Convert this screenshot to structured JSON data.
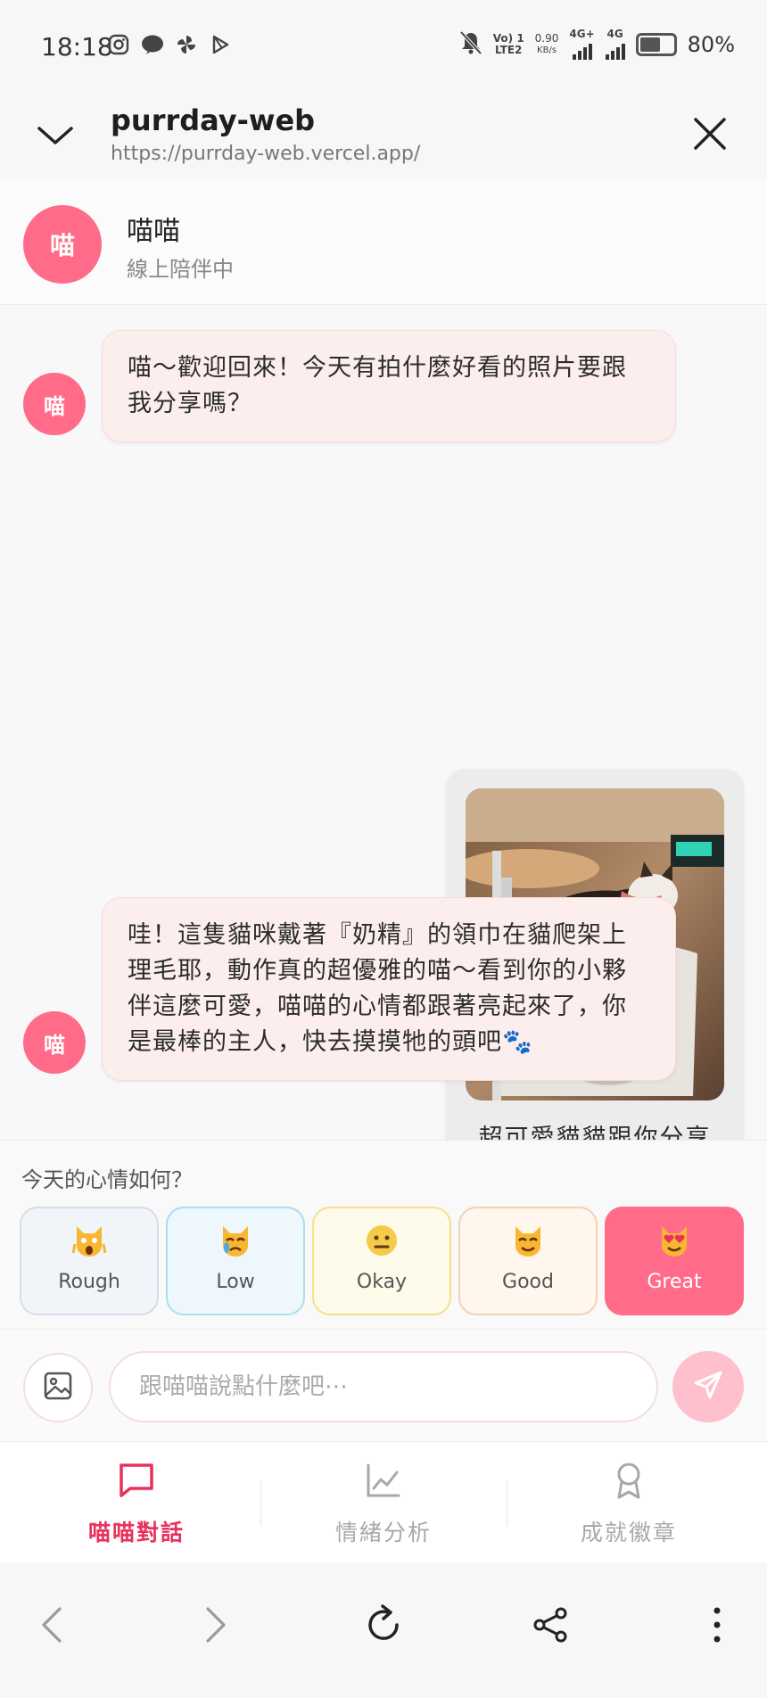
{
  "status_bar": {
    "time": "18:18",
    "volte": "Vo) 1",
    "lte": "LTE2",
    "speed_value": "0.90",
    "speed_unit": "KB/s",
    "net1": "4G+",
    "net2": "4G",
    "battery": "80%"
  },
  "browser": {
    "title": "purrday-web",
    "url": "https://purrday-web.vercel.app/"
  },
  "chat": {
    "avatar_char": "喵",
    "name": "喵喵",
    "status": "線上陪伴中",
    "messages": [
      {
        "from": "bot",
        "text": "喵～歡迎回來！今天有拍什麼好看的照片要跟我分享嗎？"
      },
      {
        "from": "user",
        "type": "photo",
        "caption": "超可愛貓貓跟你分享"
      },
      {
        "from": "bot",
        "text": "哇！這隻貓咪戴著『奶精』的領巾在貓爬架上理毛耶，動作真的超優雅的喵～看到你的小夥伴這麼可愛，喵喵的心情都跟著亮起來了，你是最棒的主人，快去摸摸牠的頭吧🐾"
      }
    ]
  },
  "mood": {
    "question": "今天的心情如何？",
    "options": [
      {
        "label": "Rough",
        "icon": "weary-cat-emoji"
      },
      {
        "label": "Low",
        "icon": "crying-cat-emoji"
      },
      {
        "label": "Okay",
        "icon": "neutral-face-emoji"
      },
      {
        "label": "Good",
        "icon": "cat-face-emoji"
      },
      {
        "label": "Great",
        "icon": "heart-eyes-cat-emoji",
        "selected": true
      }
    ]
  },
  "input": {
    "placeholder": "跟喵喵說點什麼吧⋯"
  },
  "nav": {
    "tabs": [
      {
        "label": "喵喵對話",
        "icon": "chat-icon",
        "active": true
      },
      {
        "label": "情緒分析",
        "icon": "chart-icon"
      },
      {
        "label": "成就徽章",
        "icon": "badge-icon"
      }
    ]
  },
  "colors": {
    "accent": "#ff6b88",
    "accent_dark": "#e8305b",
    "bot_bubble": "#fdeeee"
  }
}
